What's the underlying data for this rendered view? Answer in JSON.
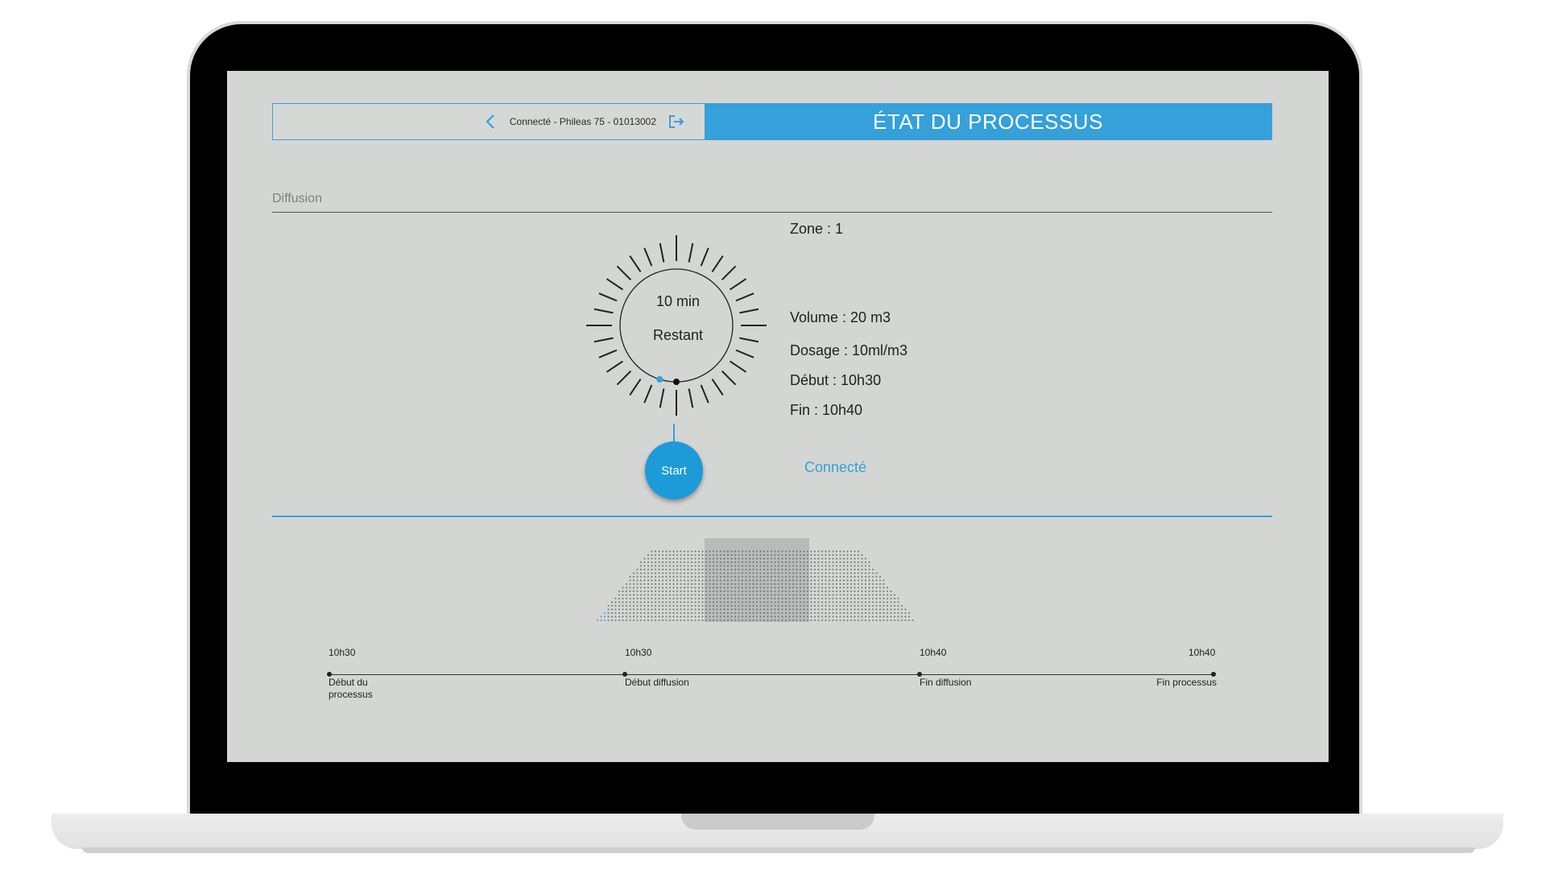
{
  "header": {
    "connection_label": "Connecté - Phileas 75 - 01013002",
    "title": "ÉTAT DU PROCESSUS"
  },
  "section": {
    "label": "Diffusion"
  },
  "dial": {
    "time": "10 min",
    "status": "Restant"
  },
  "start_button": {
    "label": "Start"
  },
  "info": {
    "zone": "Zone : 1",
    "volume": "Volume : 20 m3",
    "dosage": "Dosage : 10ml/m3",
    "debut": "Début : 10h30",
    "fin": "Fin : 10h40"
  },
  "connection_status": "Connecté",
  "timeline": {
    "points": [
      {
        "time": "10h30",
        "caption": "Début du processus"
      },
      {
        "time": "10h30",
        "caption": "Début diffusion"
      },
      {
        "time": "10h40",
        "caption": "Fin diffusion"
      },
      {
        "time": "10h40",
        "caption": "Fin processus"
      }
    ]
  },
  "colors": {
    "accent": "#35a0d9",
    "screen_bg": "#d4d6d4",
    "dot_color": "#6f7171",
    "highlight_band": "#b9bbbb"
  },
  "icons": {
    "back": "chevron-left-icon",
    "logout": "logout-icon"
  }
}
